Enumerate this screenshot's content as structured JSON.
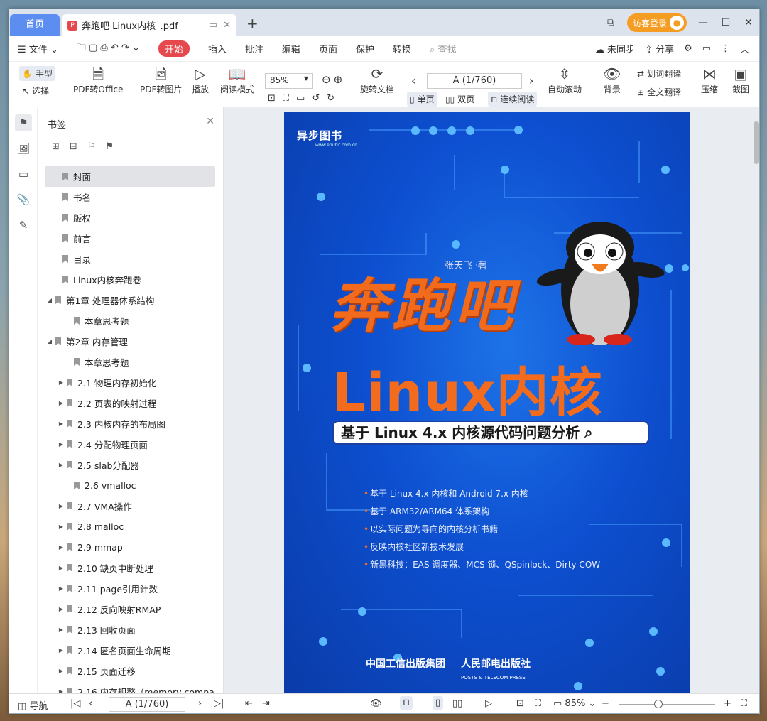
{
  "tabs": {
    "home": "首页",
    "doc_title": "奔跑吧 Linux内核_.pdf"
  },
  "header": {
    "login": "访客登录"
  },
  "menu": {
    "file": "文件",
    "start": "开始",
    "items": [
      "插入",
      "批注",
      "编辑",
      "页面",
      "保护",
      "转换"
    ],
    "search": "查找",
    "sync": "未同步",
    "share": "分享"
  },
  "toolbar": {
    "hand": "手型",
    "select": "选择",
    "pdf_office": "PDF转Office",
    "pdf_image": "PDF转图片",
    "play": "播放",
    "read_mode": "阅读模式",
    "zoom": "85%",
    "page": "A (1/760)",
    "rotate": "旋转文档",
    "single": "单页",
    "double": "双页",
    "continuous": "连续阅读",
    "auto_scroll": "自动滚动",
    "background": "背景",
    "word_translate": "划词翻译",
    "full_translate": "全文翻译",
    "compress": "压缩",
    "screenshot": "截图"
  },
  "panel": {
    "title": "书签"
  },
  "bookmarks": [
    {
      "label": "封面",
      "level": 0,
      "tri": "",
      "active": true
    },
    {
      "label": "书名",
      "level": 0,
      "tri": ""
    },
    {
      "label": "版权",
      "level": 0,
      "tri": ""
    },
    {
      "label": "前言",
      "level": 0,
      "tri": ""
    },
    {
      "label": "目录",
      "level": 0,
      "tri": ""
    },
    {
      "label": "Linux内核奔跑卷",
      "level": 0,
      "tri": ""
    },
    {
      "label": "第1章 处理器体系结构",
      "level": 0,
      "tri": "◢"
    },
    {
      "label": "本章思考题",
      "level": 1,
      "tri": ""
    },
    {
      "label": "第2章 内存管理",
      "level": 0,
      "tri": "◢"
    },
    {
      "label": "本章思考题",
      "level": 1,
      "tri": ""
    },
    {
      "label": "2.1 物理内存初始化",
      "level": 1,
      "tri": "▶"
    },
    {
      "label": "2.2 页表的映射过程",
      "level": 1,
      "tri": "▶"
    },
    {
      "label": "2.3 内核内存的布局图",
      "level": 1,
      "tri": "▶"
    },
    {
      "label": "2.4 分配物理页面",
      "level": 1,
      "tri": "▶"
    },
    {
      "label": "2.5 slab分配器",
      "level": 1,
      "tri": "▶"
    },
    {
      "label": "2.6 vmalloc",
      "level": 1,
      "tri": ""
    },
    {
      "label": "2.7 VMA操作",
      "level": 1,
      "tri": "▶"
    },
    {
      "label": "2.8 malloc",
      "level": 1,
      "tri": "▶"
    },
    {
      "label": "2.9 mmap",
      "level": 1,
      "tri": "▶"
    },
    {
      "label": "2.10 缺页中断处理",
      "level": 1,
      "tri": "▶"
    },
    {
      "label": "2.11 page引用计数",
      "level": 1,
      "tri": "▶"
    },
    {
      "label": "2.12 反向映射RMAP",
      "level": 1,
      "tri": "▶"
    },
    {
      "label": "2.13 回收页面",
      "level": 1,
      "tri": "▶"
    },
    {
      "label": "2.14 匿名页面生命周期",
      "level": 1,
      "tri": "▶"
    },
    {
      "label": "2.15 页面迁移",
      "level": 1,
      "tri": "▶"
    },
    {
      "label": "2.16 内存规整（memory compa",
      "level": 1,
      "tri": "▶"
    }
  ],
  "cover": {
    "publisher_logo": "异步图书",
    "publisher_url": "www.epubit.com.cn",
    "author": "张天飞◦著",
    "title_cn": "奔跑吧",
    "title_linux": "Linux内核",
    "subtitle": "基于 Linux 4.x 内核源代码问题分析",
    "bullets": [
      "基于 Linux 4.x 内核和 Android 7.x 内核",
      "基于 ARM32/ARM64 体系架构",
      "以实际问题为导向的内核分析书籍",
      "反映内核社区新技术发展",
      "新黑科技：EAS 调度器、MCS 锁、QSpinlock、Dirty COW"
    ],
    "publishers": [
      "中国工信出版集团",
      "人民邮电出版社"
    ],
    "publisher_en": "POSTS & TELECOM PRESS"
  },
  "status": {
    "nav": "导航",
    "page": "A (1/760)",
    "zoom": "85%"
  }
}
